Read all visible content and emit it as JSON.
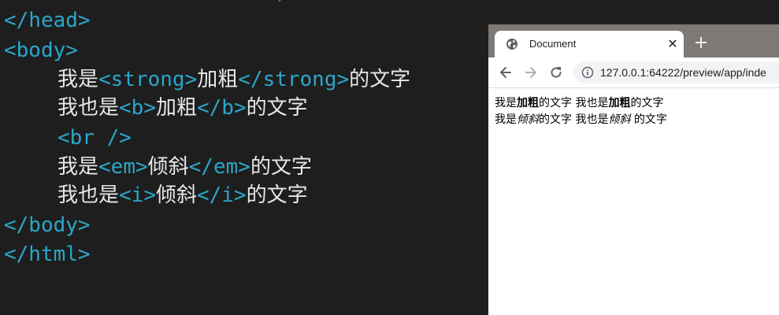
{
  "editor": {
    "lines": [
      {
        "tag": "</head>"
      },
      {
        "tag": "<body>"
      },
      {
        "t1": "我是",
        "o": "<strong>",
        "t2": "加粗",
        "c": "</strong>",
        "t3": "的文字"
      },
      {
        "t1": "我也是",
        "o": "<b>",
        "t2": "加粗",
        "c": "</b>",
        "t3": "的文字"
      },
      {
        "tag": "<br />"
      },
      {
        "t1": "我是",
        "o": "<em>",
        "t2": "倾斜",
        "c": "</em>",
        "t3": "的文字"
      },
      {
        "t1": "我也是",
        "o": "<i>",
        "t2": "倾斜",
        "c": "</i>",
        "t3": "的文字"
      },
      {
        "tag": "</body>"
      },
      {
        "tag": "</html>"
      }
    ],
    "colors": {
      "background": "#1e1e1e",
      "tag": "#2aa6c8",
      "text": "#e8e8e8"
    }
  },
  "browser": {
    "tab": {
      "title": "Document",
      "close": "✕",
      "new_tab": "+"
    },
    "address": {
      "url": "127.0.0.1:64222/preview/app/inde"
    },
    "icons": [
      "globe-icon",
      "back-arrow-icon",
      "forward-arrow-icon",
      "reload-icon",
      "info-icon"
    ],
    "content": {
      "line1": {
        "a": "我是",
        "b": "加粗",
        "c": "的文字 我也是",
        "d": "加粗",
        "e": "的文字"
      },
      "line2": {
        "a": "我是",
        "b": "倾斜",
        "c": "的文字 我也是",
        "d": "倾斜",
        "e": " 的文字"
      }
    },
    "colors": {
      "tabstrip": "#7e7975",
      "omnibox": "#f1f3f4"
    }
  }
}
